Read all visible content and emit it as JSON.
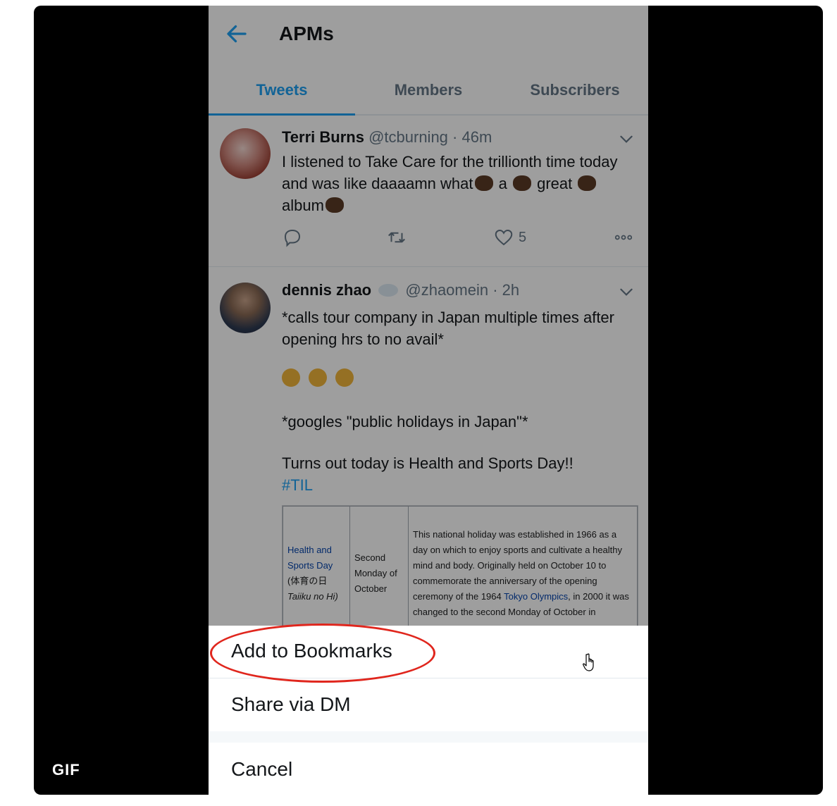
{
  "header": {
    "title": "APMs"
  },
  "tabs": [
    {
      "label": "Tweets",
      "active": true
    },
    {
      "label": "Members",
      "active": false
    },
    {
      "label": "Subscribers",
      "active": false
    }
  ],
  "tweets": [
    {
      "name": "Terri Burns",
      "handle": "@tcburning",
      "time": "· 46m",
      "text_parts": [
        "I listened to Take Care for the trillionth time today and was like daaaamn what",
        "a",
        "great",
        "album"
      ],
      "likes": "5"
    },
    {
      "name": "dennis zhao",
      "handle": "@zhaomein",
      "time": "· 2h",
      "text1": "*calls tour company in Japan multiple times after opening hrs to no avail*",
      "text2": "*googles \"public holidays in Japan\"*",
      "text3": "Turns out today is Health and Sports Day!!",
      "hashtag": "#TIL",
      "wiki": {
        "holiday_line1": "Health and",
        "holiday_line2": "Sports Day",
        "holiday_line3": "(体育の日",
        "holiday_line4": "Taiiku no Hi)",
        "date_line1": "Second",
        "date_line2": "Monday of",
        "date_line3": "October",
        "desc_part1": "This national holiday was established in 1966 as a day on which to enjoy sports and cultivate a healthy mind and body. Originally held on October 10 to commemorate the anniversary of the opening ceremony of the 1964",
        "desc_link": "Tokyo Olympics",
        "desc_part2": ", in 2000 it was changed to the second Monday of October in"
      }
    }
  ],
  "sheet": {
    "items": [
      "Add to Bookmarks",
      "Share via DM",
      "Cancel"
    ]
  },
  "badge": "GIF",
  "colors": {
    "accent": "#1da1f2",
    "highlight": "#e0261d",
    "frame": "#000000"
  }
}
